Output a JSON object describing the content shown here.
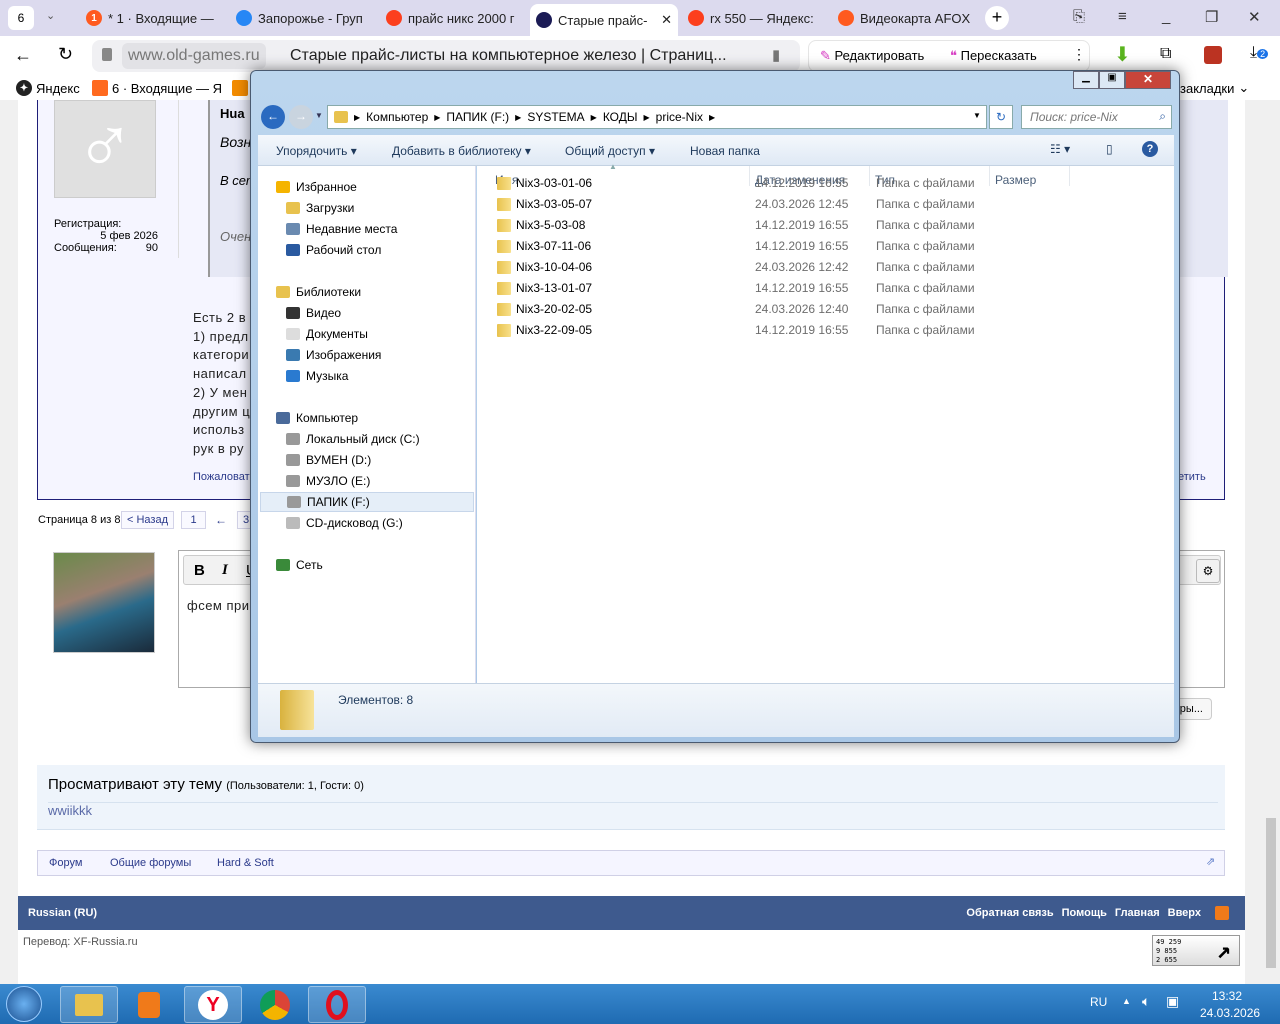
{
  "browser": {
    "tab_count": "6",
    "tabs": [
      {
        "title": "* 1 · Входящие —",
        "badge": "1",
        "color": "#ff5a1f"
      },
      {
        "title": "Запорожье - Груп",
        "color": "#2787f5"
      },
      {
        "title": "прайс никс 2000 г",
        "color": "#fc3f1d"
      },
      {
        "title": "Старые прайс-",
        "color": "#1b1b55",
        "active": true
      },
      {
        "title": "rx 550 — Яндекс:",
        "color": "#fc3f1d"
      },
      {
        "title": "Видеокарта AFOX",
        "color": "#ff5a1f"
      }
    ],
    "domain": "www.old-games.ru",
    "page_title": "Старые прайс-листы на компьютерное железо | Страниц...",
    "edit_label": "Редактировать",
    "retell_label": "Пересказать",
    "downloads_badge": "2",
    "bookmarks": [
      {
        "label": "Яндекс"
      },
      {
        "label": "6 · Входящие — Я"
      }
    ],
    "bookmarks_more": "закладки"
  },
  "forum": {
    "registration_label": "Регистрация:",
    "registration_date": "5 фев 2026",
    "messages_label": "Сообщения:",
    "messages_count": "90",
    "quote_author": "Hua",
    "quote_lines": [
      "Возн",
      "В сет",
      "Очен"
    ],
    "post_lines": [
      "Есть 2 в",
      "1) предл",
      "категори",
      "написал",
      "2) У мен",
      "другим ц",
      "использ",
      "рук в ру"
    ],
    "report_link": "Пожаловат",
    "reply_link": "етить",
    "pagination": {
      "label": "Страница 8 из 8",
      "prev": "< Назад",
      "first": "1",
      "arrow": "←",
      "next_partial": "3"
    },
    "editor": {
      "bold": "B",
      "italic": "I",
      "underline": "U",
      "text": "фсем при"
    },
    "options_button": "етры...",
    "viewers": {
      "title": "Просматривают эту тему",
      "counts": "(Пользователи: 1, Гости: 0)",
      "users": "wwiikkk"
    },
    "breadcrumb": [
      "Форум",
      "Общие форумы",
      "Hard & Soft"
    ],
    "footer": {
      "language": "Russian (RU)",
      "links": [
        "Обратная связь",
        "Помощь",
        "Главная",
        "Вверх"
      ]
    },
    "translation": "Перевод: XF-Russia.ru",
    "counter": [
      "49 259",
      "9 855",
      "2 655"
    ]
  },
  "explorer": {
    "path": [
      "Компьютер",
      "ПАПИК (F:)",
      "SYSTEMA",
      "КОДЫ",
      "price-Nix"
    ],
    "search_placeholder": "Поиск: price-Nix",
    "toolbar": [
      "Упорядочить",
      "Добавить в библиотеку",
      "Общий доступ",
      "Новая папка"
    ],
    "columns": [
      "Имя",
      "Дата изменения",
      "Тип",
      "Размер"
    ],
    "nav": [
      {
        "label": "Избранное",
        "group": true,
        "icon": "star-icon"
      },
      {
        "label": "Загрузки",
        "icon": "downloads-icon"
      },
      {
        "label": "Недавние места",
        "icon": "recent-places-icon"
      },
      {
        "label": "Рабочий стол",
        "icon": "desktop-icon"
      },
      {
        "label": "Библиотеки",
        "group": true,
        "icon": "libraries-icon"
      },
      {
        "label": "Видео",
        "icon": "video-icon"
      },
      {
        "label": "Документы",
        "icon": "documents-icon"
      },
      {
        "label": "Изображения",
        "icon": "pictures-icon"
      },
      {
        "label": "Музыка",
        "icon": "music-icon"
      },
      {
        "label": "Компьютер",
        "group": true,
        "icon": "computer-icon"
      },
      {
        "label": "Локальный диск (C:)",
        "icon": "drive-icon"
      },
      {
        "label": "ВУМЕН (D:)",
        "icon": "drive-icon"
      },
      {
        "label": "МУЗЛО (E:)",
        "icon": "drive-icon"
      },
      {
        "label": "ПАПИК (F:)",
        "icon": "drive-icon",
        "selected": true
      },
      {
        "label": "CD-дисковод (G:)",
        "icon": "cd-drive-icon"
      },
      {
        "label": "Сеть",
        "group": true,
        "icon": "network-icon"
      }
    ],
    "files": [
      {
        "name": "Nix3-03-01-06",
        "date": "14.12.2019 16:55",
        "type": "Папка с файлами"
      },
      {
        "name": "Nix3-03-05-07",
        "date": "24.03.2026 12:45",
        "type": "Папка с файлами"
      },
      {
        "name": "Nix3-5-03-08",
        "date": "14.12.2019 16:55",
        "type": "Папка с файлами"
      },
      {
        "name": "Nix3-07-11-06",
        "date": "14.12.2019 16:55",
        "type": "Папка с файлами"
      },
      {
        "name": "Nix3-10-04-06",
        "date": "24.03.2026 12:42",
        "type": "Папка с файлами"
      },
      {
        "name": "Nix3-13-01-07",
        "date": "14.12.2019 16:55",
        "type": "Папка с файлами"
      },
      {
        "name": "Nix3-20-02-05",
        "date": "24.03.2026 12:40",
        "type": "Папка с файлами"
      },
      {
        "name": "Nix3-22-09-05",
        "date": "14.12.2019 16:55",
        "type": "Папка с файлами"
      }
    ],
    "status": "Элементов: 8"
  },
  "taskbar": {
    "lang": "RU",
    "time": "13:32",
    "date": "24.03.2026"
  }
}
